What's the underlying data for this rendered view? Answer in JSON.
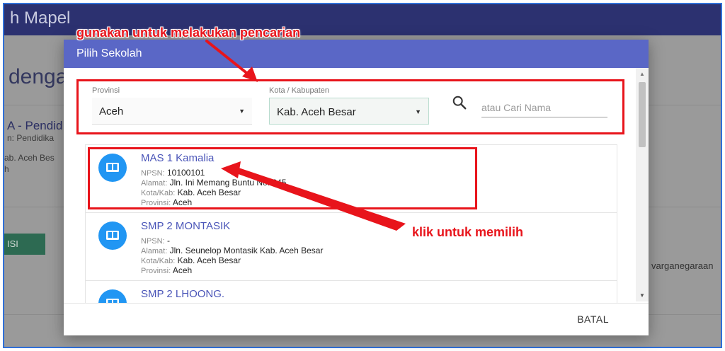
{
  "background": {
    "header_title": "h Mapel",
    "heading_fragment": "dengan",
    "course_fragment": "A - Pendid",
    "course_sub_fragment": "n: Pendidika",
    "location_fragment_1": "ab. Aceh Bes",
    "location_fragment_2": "h",
    "button_fragment": "ISI",
    "right_text_fragment": "varganegaraan"
  },
  "modal": {
    "title": "Pilih Sekolah",
    "filters": {
      "provinsi_label": "Provinsi",
      "provinsi_value": "Aceh",
      "kota_label": "Kota / Kabupaten",
      "kota_value": "Kab. Aceh Besar",
      "search_placeholder": "atau Cari Nama"
    },
    "field_labels": {
      "npsn": "NPSN:",
      "alamat": "Alamat:",
      "kota": "Kota/Kab:",
      "provinsi": "Provinsi:"
    },
    "schools": [
      {
        "name": "MAS 1 Kamalia",
        "npsn": "10100101",
        "alamat": "Jln. Ini Memang Buntu No. 245",
        "kota": "Kab. Aceh Besar",
        "provinsi": "Aceh"
      },
      {
        "name": "SMP 2 MONTASIK",
        "npsn": "-",
        "alamat": "Jln. Seunelop Montasik Kab. Aceh Besar",
        "kota": "Kab. Aceh Besar",
        "provinsi": "Aceh"
      },
      {
        "name": "SMP 2 LHOONG.",
        "npsn": "",
        "alamat": "",
        "kota": "",
        "provinsi": ""
      }
    ],
    "cancel_label": "BATAL"
  },
  "annotations": {
    "search_hint": "gunakan untuk melakukan pencarian",
    "select_hint": "klik untuk memilih",
    "color": "#e8141b"
  },
  "colors": {
    "modal_header": "#5a67c6",
    "app_header": "#2c3170",
    "avatar": "#2196f3",
    "school_name": "#4a55b8"
  },
  "icons": {
    "search": "magnifier-icon",
    "school": "book-icon"
  }
}
